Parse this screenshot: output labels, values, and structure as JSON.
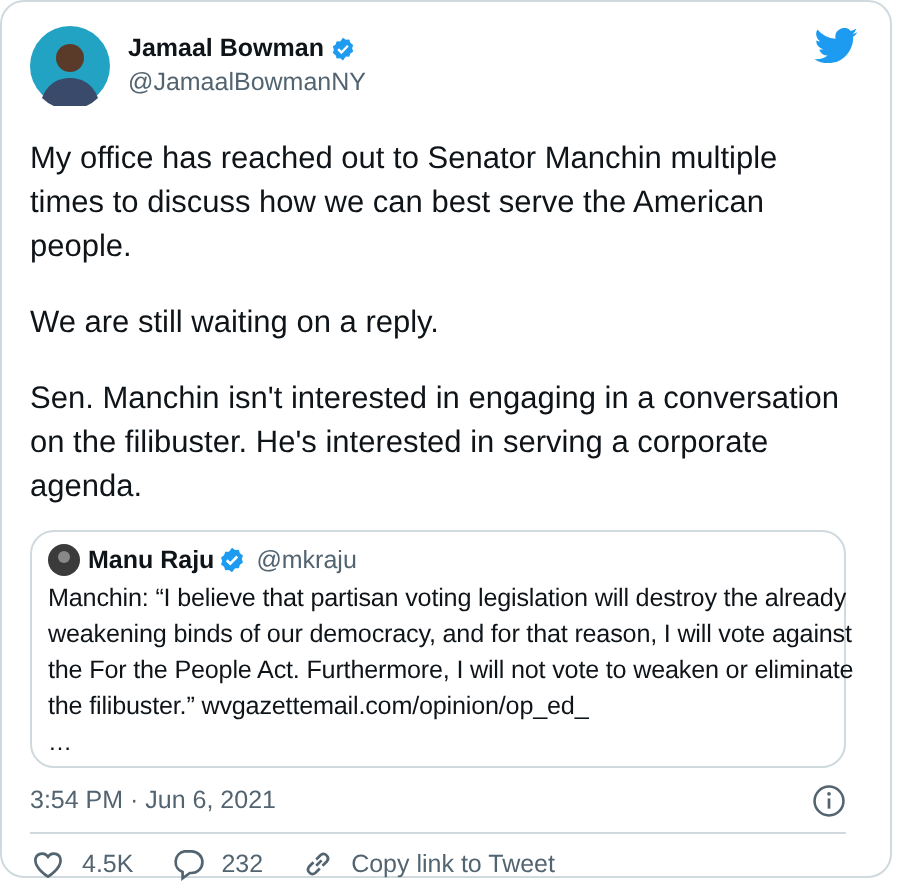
{
  "author": {
    "name": "Jamaal Bowman",
    "handle": "@JamaalBowmanNY",
    "verified": true
  },
  "paragraphs": [
    "My office has reached out to Senator Manchin multiple times to discuss how we can best serve the American people.",
    "We are still waiting on a reply.",
    "Sen. Manchin isn't interested in engaging in a conversation on the filibuster. He's interested in serving a corporate agenda."
  ],
  "quoted": {
    "name": "Manu Raju",
    "handle": "@mkraju",
    "verified": true,
    "text": "Manchin: “I believe that partisan voting legislation will destroy the already weakening binds of our democracy, and for that reason, I will vote against the For the People Act. Furthermore, I will not vote to weaken or eliminate the filibuster.” wvgazettemail.com/opinion/op_ed_",
    "more": "…"
  },
  "timestamp": "3:54 PM · Jun 6, 2021",
  "actions": [
    {
      "kind": "like",
      "label": "4.5K"
    },
    {
      "kind": "reply",
      "label": "232"
    },
    {
      "kind": "link",
      "label": "Copy link to Tweet"
    }
  ]
}
